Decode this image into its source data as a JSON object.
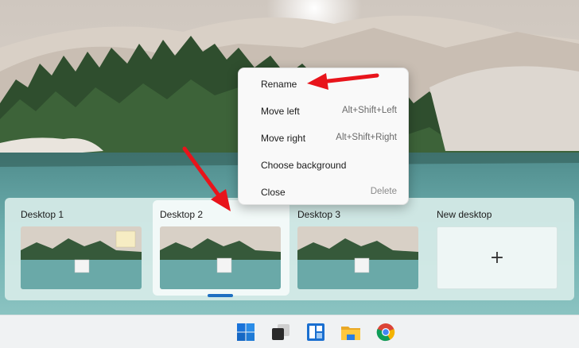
{
  "context_menu": {
    "items": [
      {
        "label": "Rename",
        "shortcut": ""
      },
      {
        "label": "Move left",
        "shortcut": "Alt+Shift+Left"
      },
      {
        "label": "Move right",
        "shortcut": "Alt+Shift+Right"
      },
      {
        "label": "Choose background",
        "shortcut": ""
      },
      {
        "label": "Close",
        "shortcut": "Delete"
      }
    ]
  },
  "task_view": {
    "desktops": [
      {
        "label": "Desktop 1"
      },
      {
        "label": "Desktop 2"
      },
      {
        "label": "Desktop 3"
      }
    ],
    "new_desktop": {
      "label": "New desktop",
      "icon": "plus-icon"
    },
    "active_desktop": "Desktop 2"
  },
  "taskbar": {
    "icons": [
      "windows-start-icon",
      "task-view-icon",
      "widgets-icon",
      "file-explorer-icon",
      "chrome-icon"
    ]
  },
  "colors": {
    "accent": "#1f6fc1",
    "annotation_arrow": "#e8141b"
  }
}
